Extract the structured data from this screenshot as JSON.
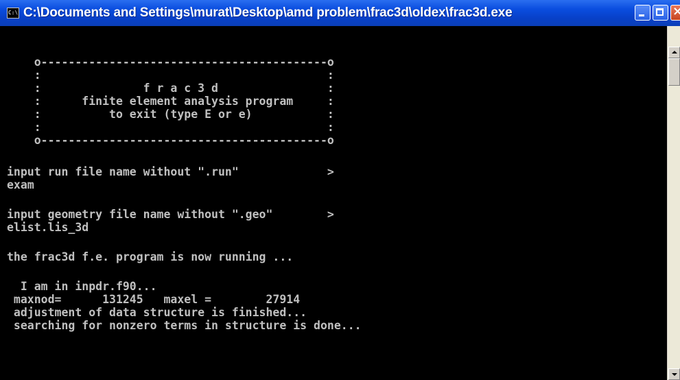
{
  "window": {
    "title": "C:\\Documents and Settings\\murat\\Desktop\\amd problem\\frac3d\\oldex\\frac3d.exe",
    "icon_label": "C:\\",
    "icon_name": "console-app-icon",
    "colors": {
      "titlebar": "#0a4ddf",
      "console_bg": "#000000",
      "console_text": "#c0c0c0"
    }
  },
  "caption_buttons": {
    "minimize_icon": "minimize-icon",
    "maximize_icon": "maximize-icon",
    "close_icon": "close-icon"
  },
  "console": {
    "lines": [
      "    o------------------------------------------o",
      "    :                                          :",
      "    :               f r a c 3 d                :",
      "    :      finite element analysis program     :",
      "    :          to exit (type E or e)           :",
      "    :                                          :",
      "    o------------------------------------------o",
      "input run file name without \".run\"             >",
      "exam",
      "input geometry file name without \".geo\"        >",
      "elist.lis_3d",
      "the frac3d f.e. program is now running ...",
      "  I am in inpdr.f90...",
      " maxnod=      131245   maxel =        27914",
      " adjustment of data structure is finished...",
      " searching for nonzero terms in structure is done..."
    ]
  },
  "scrollbar": {
    "up_icon": "scroll-up-arrow-icon",
    "down_icon": "scroll-down-arrow-icon"
  }
}
